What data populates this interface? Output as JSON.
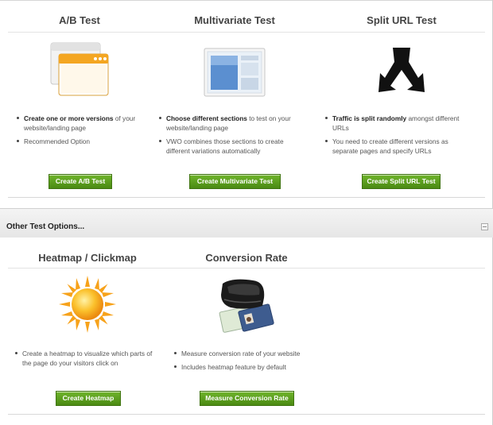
{
  "top_tests": [
    {
      "title": "A/B Test",
      "icon": "window-icon",
      "bullets": [
        {
          "bold": "Create one or more versions",
          "text": " of your website/landing page"
        },
        {
          "bold": "",
          "text": "Recommended Option"
        }
      ],
      "button": "Create A/B Test"
    },
    {
      "title": "Multivariate Test",
      "icon": "browser-sections-icon",
      "bullets": [
        {
          "bold": "Choose different sections",
          "text": " to test on your website/landing page"
        },
        {
          "bold": "",
          "text": "VWO combines those sections to create different variations automatically"
        }
      ],
      "button": "Create Multivariate Test"
    },
    {
      "title": "Split URL Test",
      "icon": "split-arrows-icon",
      "bullets": [
        {
          "bold": "Traffic is split randomly",
          "text": " amongst different URLs"
        },
        {
          "bold": "",
          "text": "You need to create different versions as separate pages and specify URLs"
        }
      ],
      "button": "Create Split URL Test"
    }
  ],
  "other_section": {
    "title": "Other Test Options..."
  },
  "other_tests": [
    {
      "title": "Heatmap / Clickmap",
      "icon": "sun-icon",
      "bullets": [
        {
          "bold": "",
          "text": "Create a heatmap to visualize which parts of the page do your visitors click on"
        }
      ],
      "button": "Create Heatmap"
    },
    {
      "title": "Conversion Rate",
      "icon": "wallet-icon",
      "bullets": [
        {
          "bold": "",
          "text": "Measure conversion rate of your website"
        },
        {
          "bold": "",
          "text": "Includes heatmap feature by default"
        }
      ],
      "button": "Measure Conversion Rate"
    }
  ],
  "colors": {
    "button_green": "#5a9e1e",
    "sun": "#f7a21a"
  }
}
